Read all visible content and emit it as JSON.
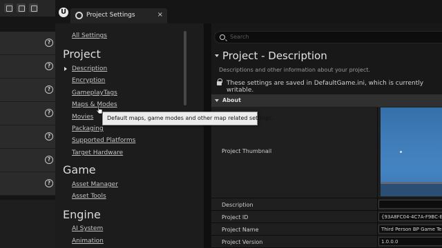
{
  "window": {
    "tab_title": "Project Settings",
    "close_glyph": "×"
  },
  "sidebar": {
    "all_settings": "All Settings",
    "groups": [
      {
        "heading": "Project",
        "items": [
          "Description",
          "Encryption",
          "GameplayTags",
          "Maps & Modes",
          "Movies",
          "Packaging",
          "Supported Platforms",
          "Target Hardware"
        ]
      },
      {
        "heading": "Game",
        "items": [
          "Asset Manager",
          "Asset Tools"
        ]
      },
      {
        "heading": "Engine",
        "items": [
          "AI System",
          "Animation"
        ]
      }
    ],
    "selected_item": "Description"
  },
  "content": {
    "search_placeholder": "Search",
    "section_title": "Project - Description",
    "section_description": "Descriptions and other information about your project.",
    "saved_notice": "These settings are saved in DefaultGame.ini, which is currently writable.",
    "category_header": "About",
    "properties": [
      {
        "name": "Project Thumbnail",
        "value": ""
      },
      {
        "name": "Description",
        "value": ""
      },
      {
        "name": "Project ID",
        "value": "{93A8FC04-4C7A-F9BC-E"
      },
      {
        "name": "Project Name",
        "value": "Third Person BP Game Te"
      },
      {
        "name": "Project Version",
        "value": "1.0.0.0"
      }
    ]
  },
  "tooltip": {
    "text": "Default maps, game modes and other map related settings."
  },
  "icons": {
    "logo": "unreal-logo-icon",
    "tab": "settings-icon",
    "search": "search-icon",
    "lock": "lock-icon",
    "help": "help-icon"
  },
  "colors": {
    "window_bg": "#0f0f0f",
    "sidebar_bg": "#1c1c1c",
    "header_bg": "#303030",
    "tooltip_bg": "#ececec",
    "thumbnail_sky": "#3f7cb8"
  }
}
